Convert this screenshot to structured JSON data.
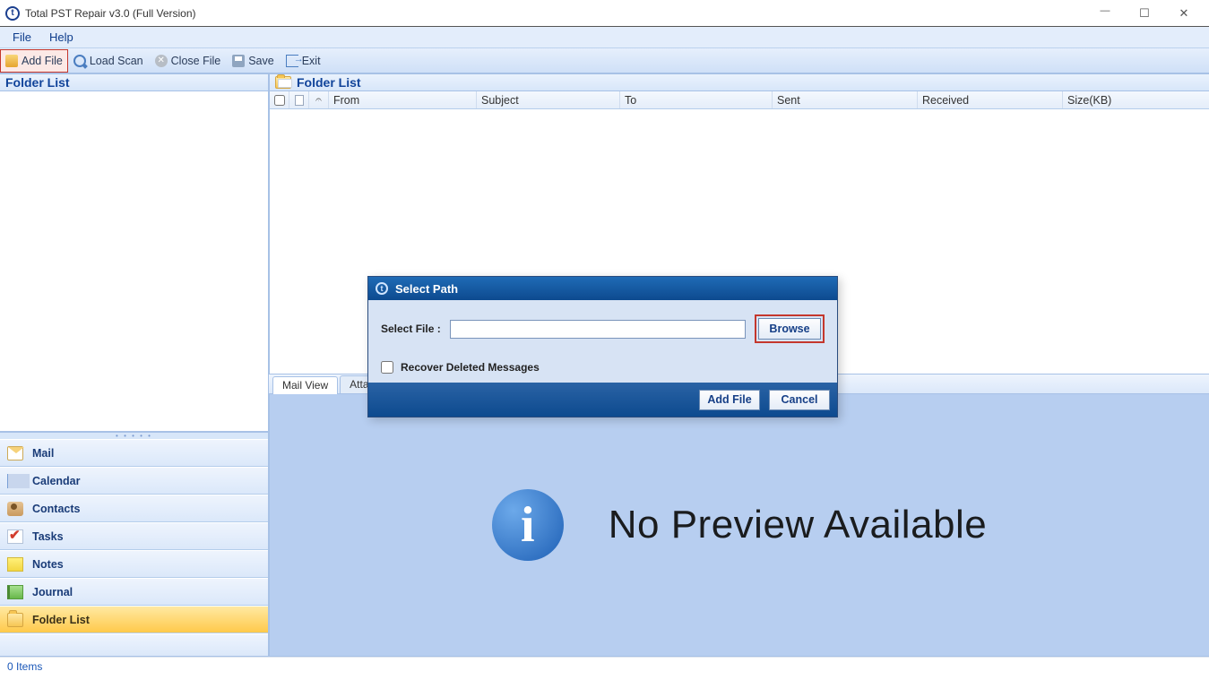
{
  "app": {
    "title": "Total PST Repair v3.0 (Full Version)"
  },
  "menu": {
    "file": "File",
    "help": "Help"
  },
  "toolbar": {
    "add_file": "Add File",
    "load_scan": "Load Scan",
    "close_file": "Close File",
    "save": "Save",
    "exit": "Exit"
  },
  "left": {
    "header": "Folder List"
  },
  "nav": {
    "mail": "Mail",
    "calendar": "Calendar",
    "contacts": "Contacts",
    "tasks": "Tasks",
    "notes": "Notes",
    "journal": "Journal",
    "folder_list": "Folder List"
  },
  "right": {
    "header": "Folder List",
    "columns": {
      "from": "From",
      "subject": "Subject",
      "to": "To",
      "sent": "Sent",
      "received": "Received",
      "size": "Size(KB)"
    },
    "tabs": {
      "mail_view": "Mail View",
      "attachment": "Attachm"
    },
    "preview_msg": "No Preview Available"
  },
  "dialog": {
    "title": "Select Path",
    "select_file_label": "Select File :",
    "file_value": "",
    "browse": "Browse",
    "recover_label": "Recover Deleted Messages",
    "add_file": "Add File",
    "cancel": "Cancel"
  },
  "status": {
    "items": "0 Items"
  }
}
